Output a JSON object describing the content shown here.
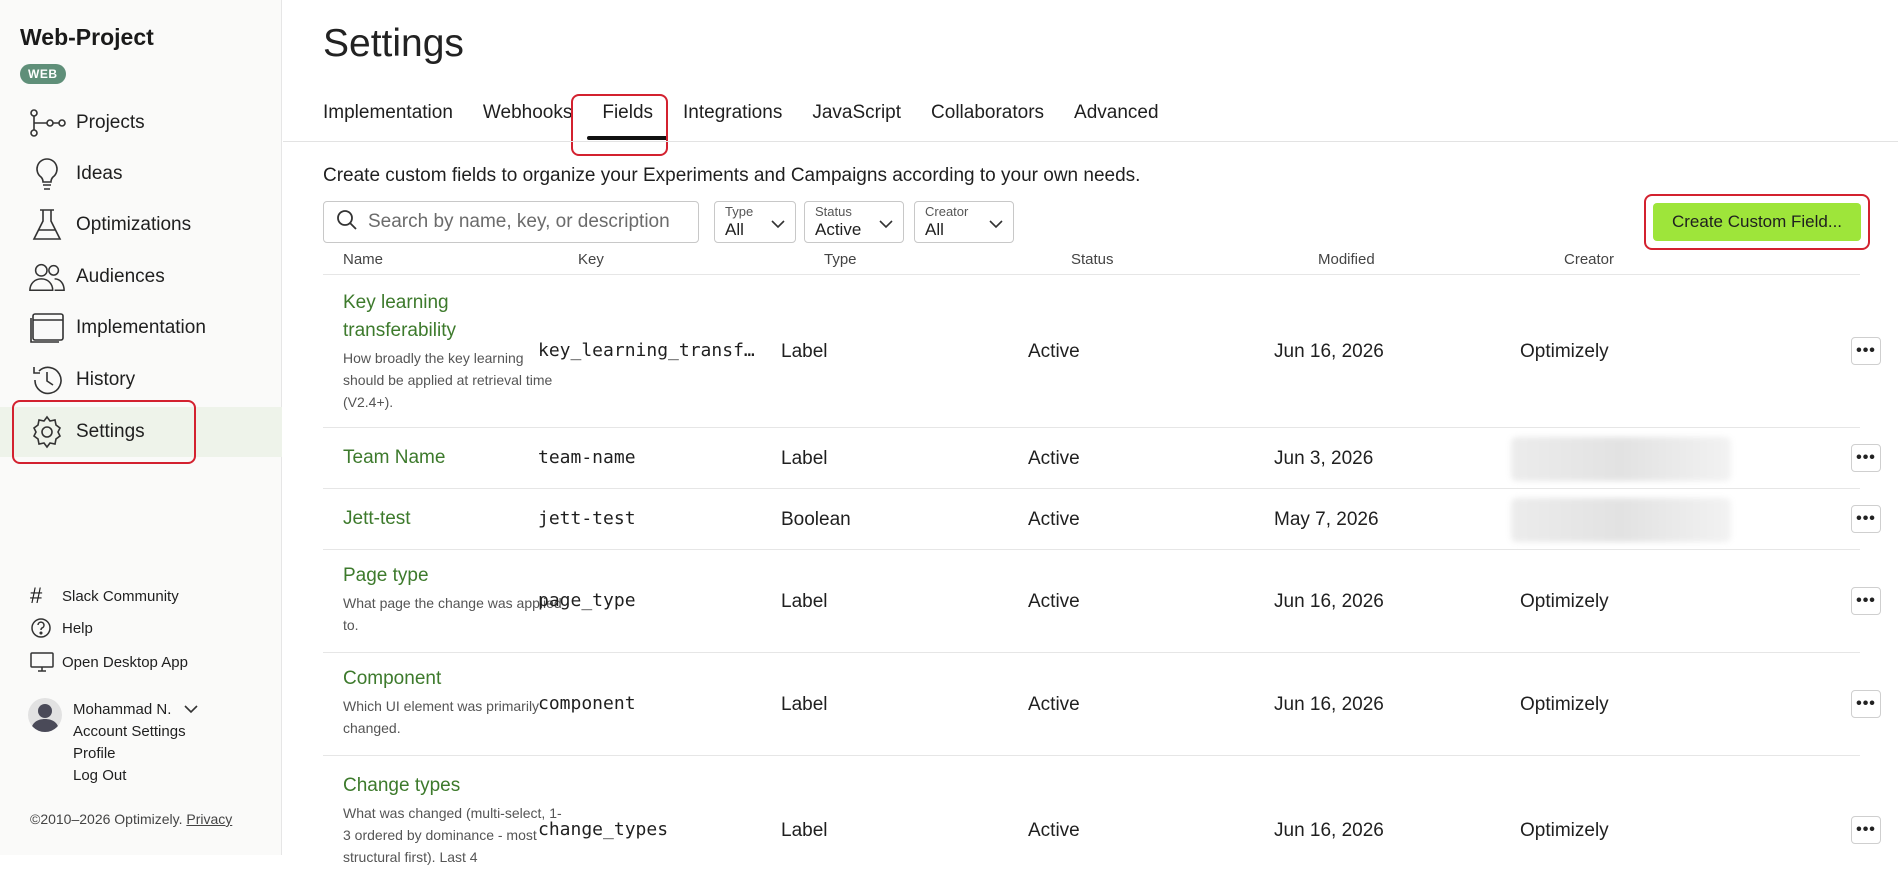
{
  "sidebar": {
    "project_title": "Web-Project",
    "project_badge": "WEB",
    "nav": [
      {
        "label": "Projects",
        "icon": "projects-icon"
      },
      {
        "label": "Ideas",
        "icon": "lightbulb-icon"
      },
      {
        "label": "Optimizations",
        "icon": "flask-icon"
      },
      {
        "label": "Audiences",
        "icon": "people-icon"
      },
      {
        "label": "Implementation",
        "icon": "browser-window-icon"
      },
      {
        "label": "History",
        "icon": "history-icon"
      },
      {
        "label": "Settings",
        "icon": "gear-icon",
        "active": true
      }
    ],
    "footer": {
      "slack": "Slack Community",
      "help": "Help",
      "desktop": "Open Desktop App"
    },
    "user": {
      "name": "Mohammad N.",
      "account_settings": "Account Settings",
      "profile": "Profile",
      "logout": "Log Out"
    },
    "copyright": "©2010–2026 Optimizely.",
    "privacy": "Privacy"
  },
  "main": {
    "title": "Settings",
    "tabs": [
      {
        "label": "Implementation"
      },
      {
        "label": "Webhooks"
      },
      {
        "label": "Fields",
        "active": true
      },
      {
        "label": "Integrations"
      },
      {
        "label": "JavaScript"
      },
      {
        "label": "Collaborators"
      },
      {
        "label": "Advanced"
      }
    ],
    "description": "Create custom fields to organize your Experiments and Campaigns according to your own needs.",
    "search": {
      "placeholder": "Search by name, key, or description"
    },
    "filters": [
      {
        "label": "Type",
        "value": "All"
      },
      {
        "label": "Status",
        "value": "Active"
      },
      {
        "label": "Creator",
        "value": "All"
      }
    ],
    "create_button": "Create Custom Field...",
    "columns": [
      "Name",
      "Key",
      "Type",
      "Status",
      "Modified",
      "Creator"
    ],
    "rows": [
      {
        "name": "Key learning transferability",
        "desc": "How broadly the key learning should be applied at retrieval time (V2.4+).",
        "key": "key_learning_transferability",
        "type": "Label",
        "status": "Active",
        "modified": "Jun 16, 2026",
        "creator": "Optimizely"
      },
      {
        "name": "Team Name",
        "desc": "",
        "key": "team-name",
        "type": "Label",
        "status": "Active",
        "modified": "Jun 3, 2026",
        "creator": ""
      },
      {
        "name": "Jett-test",
        "desc": "",
        "key": "jett-test",
        "type": "Boolean",
        "status": "Active",
        "modified": "May 7, 2026",
        "creator": ""
      },
      {
        "name": "Page type",
        "desc": "What page the change was applied to.",
        "key": "page_type",
        "type": "Label",
        "status": "Active",
        "modified": "Jun 16, 2026",
        "creator": "Optimizely"
      },
      {
        "name": "Component",
        "desc": "Which UI element was primarily changed.",
        "key": "component",
        "type": "Label",
        "status": "Active",
        "modified": "Jun 16, 2026",
        "creator": "Optimizely"
      },
      {
        "name": "Change types",
        "desc": "What was changed (multi-select, 1-3 ordered by dominance - most structural first). Last 4",
        "key": "change_types",
        "type": "Label",
        "status": "Active",
        "modified": "Jun 16, 2026",
        "creator": "Optimizely"
      }
    ]
  }
}
